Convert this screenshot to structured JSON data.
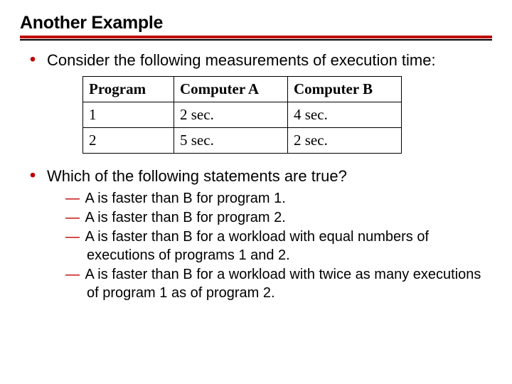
{
  "title": "Another Example",
  "bullet1": "Consider the following measurements of execution time:",
  "table": {
    "headers": [
      "Program",
      "Computer A",
      "Computer B"
    ],
    "rows": [
      [
        "1",
        "2 sec.",
        "4 sec."
      ],
      [
        "2",
        "5 sec.",
        "2 sec."
      ]
    ]
  },
  "bullet2": "Which of the following statements are true?",
  "subitems": [
    "A is faster than B for program 1.",
    "A is faster than B for program 2.",
    "A is faster than B for a workload with equal numbers of executions of programs 1 and 2.",
    "A is faster than B for a workload with twice as many executions of program 1 as of program 2."
  ]
}
